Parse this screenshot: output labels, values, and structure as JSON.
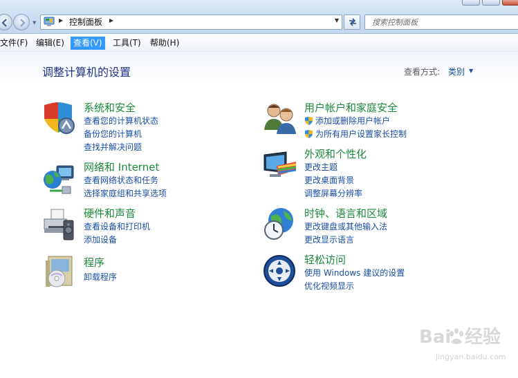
{
  "address_bar": {
    "breadcrumb": "控制面板",
    "search_placeholder": "搜索控制面板"
  },
  "menu": {
    "file": "文件(F)",
    "edit": "编辑(E)",
    "view": "查看(V)",
    "tools": "工具(T)",
    "help": "帮助(H)",
    "active": "view"
  },
  "main": {
    "heading": "调整计算机的设置",
    "view_by_label": "查看方式:",
    "view_by_value": "类别"
  },
  "categories": [
    {
      "title": "系统和安全",
      "icon": "shield-icon",
      "links": [
        "查看您的计算机状态",
        "备份您的计算机",
        "查找并解决问题"
      ]
    },
    {
      "title": "网络和 Internet",
      "icon": "network-globe-icon",
      "links": [
        "查看网络状态和任务",
        "选择家庭组和共享选项"
      ]
    },
    {
      "title": "硬件和声音",
      "icon": "printer-icon",
      "links": [
        "查看设备和打印机",
        "添加设备"
      ]
    },
    {
      "title": "程序",
      "icon": "programs-disc-icon",
      "links": [
        "卸载程序"
      ]
    },
    {
      "title": "用户帐户和家庭安全",
      "icon": "users-icon",
      "links": [
        "添加或删除用户帐户",
        "为所有用户设置家长控制"
      ]
    },
    {
      "title": "外观和个性化",
      "icon": "monitor-palette-icon",
      "links": [
        "更改主题",
        "更改桌面背景",
        "调整屏幕分辨率"
      ]
    },
    {
      "title": "时钟、语言和区域",
      "icon": "clock-globe-icon",
      "links": [
        "更改键盘或其他输入法",
        "更改显示语言"
      ]
    },
    {
      "title": "轻松访问",
      "icon": "ease-of-access-icon",
      "links": [
        "使用 Windows 建议的设置",
        "优化视频显示"
      ]
    }
  ],
  "watermark": {
    "brand": "Bai",
    "brand_suffix": "经验",
    "url": "jingyan.baidu.com"
  },
  "colors": {
    "category_title": "#1a8a3a",
    "link": "#1a4ea6",
    "heading": "#1e3287",
    "menu_active": "#3399ff"
  }
}
